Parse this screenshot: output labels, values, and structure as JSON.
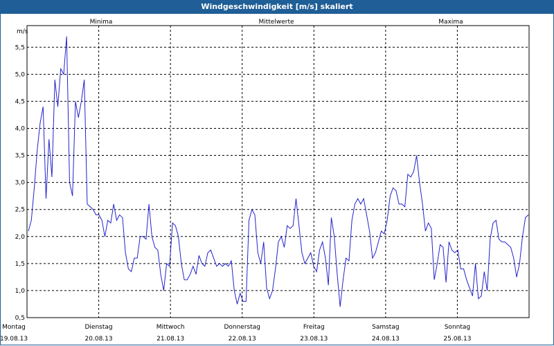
{
  "window": {
    "title": "Windgeschwindigkeit [m/s] skaliert"
  },
  "chart_data": {
    "type": "line",
    "title": "Windgeschwindigkeit [m/s] skaliert",
    "ylabel": "m/s",
    "ylim": [
      0.5,
      5.9
    ],
    "grid": true,
    "legend": [
      {
        "name": "Minima",
        "color": "#22aa22"
      },
      {
        "name": "Mittelwerte",
        "color": "#2222cc"
      },
      {
        "name": "Maxima",
        "color": "#aa2222"
      }
    ],
    "yticks": [
      "0,5",
      "1,0",
      "1,5",
      "2,0",
      "2,5",
      "3,0",
      "3,5",
      "4,0",
      "4,5",
      "5,0",
      "5,5"
    ],
    "xticks": [
      {
        "day": "Montag",
        "date": "19.08.13"
      },
      {
        "day": "Dienstag",
        "date": "20.08.13"
      },
      {
        "day": "Mittwoch",
        "date": "21.08.13"
      },
      {
        "day": "Donnerstag",
        "date": "22.08.13"
      },
      {
        "day": "Freitag",
        "date": "23.08.13"
      },
      {
        "day": "Samstag",
        "date": "24.08.13"
      },
      {
        "day": "Sonntag",
        "date": "25.08.13"
      }
    ],
    "series": [
      {
        "name": "Mittelwerte",
        "color": "#2222cc",
        "t_start": "19.08.13 00:00",
        "t_end": "26.08.13 00:00",
        "values": [
          2.1,
          2.3,
          2.9,
          3.6,
          4.1,
          4.4,
          2.7,
          3.8,
          3.1,
          4.9,
          4.4,
          5.1,
          5.0,
          5.7,
          3.0,
          2.75,
          4.5,
          4.2,
          4.5,
          4.9,
          2.6,
          2.55,
          2.5,
          2.4,
          2.4,
          2.3,
          2.0,
          2.3,
          2.25,
          2.6,
          2.3,
          2.4,
          2.35,
          1.7,
          1.4,
          1.35,
          1.6,
          1.6,
          2.0,
          2.0,
          1.95,
          2.6,
          2.0,
          1.8,
          1.75,
          1.3,
          1.0,
          1.5,
          1.45,
          2.25,
          2.2,
          2.0,
          1.5,
          1.2,
          1.2,
          1.3,
          1.45,
          1.3,
          1.65,
          1.5,
          1.45,
          1.7,
          1.75,
          1.6,
          1.45,
          1.5,
          1.45,
          1.5,
          1.45,
          1.55,
          1.0,
          0.75,
          0.95,
          0.8,
          0.8,
          2.3,
          2.5,
          2.4,
          1.7,
          1.5,
          1.9,
          1.05,
          0.85,
          1.0,
          1.4,
          1.9,
          2.0,
          1.8,
          2.2,
          2.15,
          2.2,
          2.7,
          2.2,
          1.7,
          1.5,
          1.6,
          1.7,
          1.45,
          1.35,
          1.75,
          1.9,
          1.6,
          1.1,
          2.35,
          2.0,
          1.3,
          0.7,
          1.2,
          1.6,
          1.55,
          2.3,
          2.6,
          2.7,
          2.6,
          2.7,
          2.4,
          2.1,
          1.6,
          1.7,
          1.9,
          2.1,
          2.05,
          2.3,
          2.75,
          2.9,
          2.85,
          2.6,
          2.6,
          2.55,
          3.15,
          3.1,
          3.2,
          3.5,
          3.0,
          2.6,
          2.1,
          2.25,
          2.15,
          1.2,
          1.5,
          1.85,
          1.8,
          1.15,
          1.9,
          1.75,
          1.7,
          1.75,
          1.4,
          1.4,
          1.2,
          1.05,
          0.9,
          1.5,
          0.85,
          0.9,
          1.35,
          1.0,
          1.95,
          2.25,
          2.3,
          1.95,
          1.9,
          1.9,
          1.85,
          1.8,
          1.6,
          1.25,
          1.5,
          2.0,
          2.35,
          2.4
        ]
      }
    ]
  }
}
